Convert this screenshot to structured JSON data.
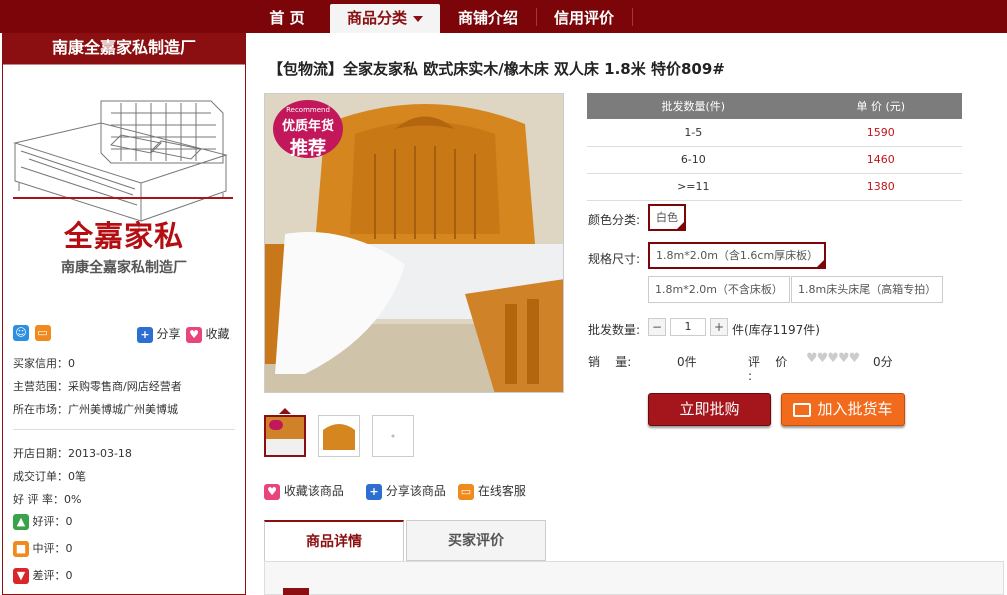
{
  "nav": {
    "items": [
      {
        "label": "首 页"
      },
      {
        "label": "商品分类"
      },
      {
        "label": "商铺介绍"
      },
      {
        "label": "信用评价"
      }
    ]
  },
  "sidebar": {
    "shop_name": "南康全嘉家私制造厂",
    "brand_big": "全嘉家私",
    "brand_sub": "南康全嘉家私制造厂",
    "share_label": "分享",
    "fav_label": "收藏",
    "rows": [
      {
        "label": "买家信用：",
        "value": "0"
      },
      {
        "label": "主营范围：",
        "value": "采购零售商/网店经营者"
      },
      {
        "label": "所在市场：",
        "value": "广州美博城广州美博城"
      }
    ],
    "stats": [
      {
        "label": "开店日期：",
        "value": "2013-03-18"
      },
      {
        "label": "成交订单：",
        "value": "0笔"
      },
      {
        "label": "好 评 率：",
        "value": "0%"
      }
    ],
    "ratings": [
      {
        "label": "好评：",
        "value": "0"
      },
      {
        "label": "中评：",
        "value": "0"
      },
      {
        "label": "差评：",
        "value": "0"
      }
    ]
  },
  "product": {
    "title": "【包物流】全家友家私 欧式床实木/橡木床 双人床 1.8米 特价809#",
    "badge_top": "Recommend",
    "badge_mid": "优质年货",
    "badge_big": "推荐",
    "actions": {
      "fav": "收藏该商品",
      "share": "分享该商品",
      "service": "在线客服"
    },
    "tabs": [
      "商品详情",
      "买家评价"
    ]
  },
  "pricing": {
    "headers": [
      "批发数量(件)",
      "单 价 (元)"
    ],
    "rows": [
      {
        "qty": "1-5",
        "price": "1590"
      },
      {
        "qty": "6-10",
        "price": "1460"
      },
      {
        "qty": ">=11",
        "price": "1380"
      }
    ],
    "color_label": "颜色分类:",
    "color_option": "白色",
    "size_label": "规格尺寸:",
    "size_options": [
      "1.8m*2.0m（含1.6cm厚床板）",
      "1.8m*2.0m（不含床板）",
      "1.8m床头床尾（高箱专拍）"
    ],
    "qty_label": "批发数量:",
    "qty_value": "1",
    "qty_unit": "件(库存1197件)",
    "sales_label": "销    量:",
    "sales_value": "0件",
    "review_label": "评    价",
    "review_colon": ":",
    "review_score": "0分",
    "buy_button": "立即批购",
    "cart_button": "加入批货车"
  },
  "colors": {
    "brand": "#7b0509",
    "price": "#c0141a",
    "cart": "#f26b1d"
  }
}
